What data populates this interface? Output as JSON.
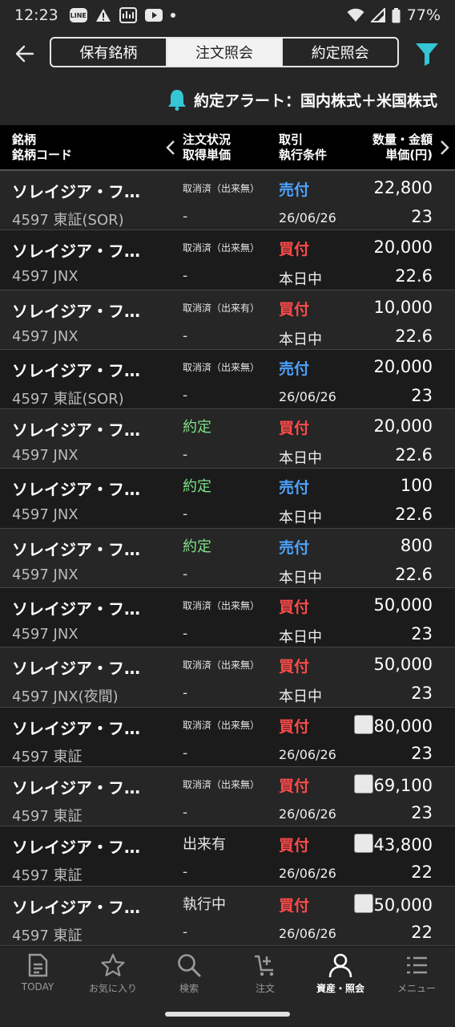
{
  "status_bar": {
    "time": "12:23",
    "battery": "77%"
  },
  "header": {
    "tabs": [
      "保有銘柄",
      "注文照会",
      "約定照会"
    ],
    "active_tab": 1,
    "alert_text": "約定アラート：国内株式＋米国株式"
  },
  "columns": {
    "name": "銘柄",
    "code": "銘柄コード",
    "status": "注文状況",
    "acq": "取得単価",
    "trade": "取引",
    "cond": "執行条件",
    "qty": "数量・金額",
    "price": "単価(円)"
  },
  "orders": [
    {
      "name": "ソレイジア・フ…",
      "code": "4597 東証(SOR)",
      "status": "取消済（出来無）",
      "acq": "-",
      "side": "売付",
      "cond": "26/06/26",
      "qty": "22,800",
      "price": "23"
    },
    {
      "name": "ソレイジア・フ…",
      "code": "4597 JNX",
      "status": "取消済（出来無）",
      "acq": "-",
      "side": "買付",
      "cond": "本日中",
      "qty": "20,000",
      "price": "22.6"
    },
    {
      "name": "ソレイジア・フ…",
      "code": "4597 JNX",
      "status": "取消済（出来有）",
      "acq": "-",
      "side": "買付",
      "cond": "本日中",
      "qty": "10,000",
      "price": "22.6"
    },
    {
      "name": "ソレイジア・フ…",
      "code": "4597 東証(SOR)",
      "status": "取消済（出来無）",
      "acq": "-",
      "side": "売付",
      "cond": "26/06/26",
      "qty": "20,000",
      "price": "23"
    },
    {
      "name": "ソレイジア・フ…",
      "code": "4597 JNX",
      "status": "約定",
      "acq": "-",
      "side": "買付",
      "cond": "本日中",
      "qty": "20,000",
      "price": "22.6"
    },
    {
      "name": "ソレイジア・フ…",
      "code": "4597 JNX",
      "status": "約定",
      "acq": "-",
      "side": "売付",
      "cond": "本日中",
      "qty": "100",
      "price": "22.6"
    },
    {
      "name": "ソレイジア・フ…",
      "code": "4597 JNX",
      "status": "約定",
      "acq": "-",
      "side": "売付",
      "cond": "本日中",
      "qty": "800",
      "price": "22.6"
    },
    {
      "name": "ソレイジア・フ…",
      "code": "4597 JNX",
      "status": "取消済（出来無）",
      "acq": "-",
      "side": "買付",
      "cond": "本日中",
      "qty": "50,000",
      "price": "23"
    },
    {
      "name": "ソレイジア・フ…",
      "code": "4597 JNX(夜間)",
      "status": "取消済（出来無）",
      "acq": "-",
      "side": "買付",
      "cond": "本日中",
      "qty": "50,000",
      "price": "23"
    },
    {
      "name": "ソレイジア・フ…",
      "code": "4597 東証",
      "status": "取消済（出来無）",
      "acq": "-",
      "side": "買付",
      "cond": "26/06/26",
      "qty": "80,000",
      "qty_box": true,
      "price": "23"
    },
    {
      "name": "ソレイジア・フ…",
      "code": "4597 東証",
      "status": "取消済（出来無）",
      "acq": "-",
      "side": "買付",
      "cond": "26/06/26",
      "qty": "69,100",
      "qty_box": true,
      "price": "23"
    },
    {
      "name": "ソレイジア・フ…",
      "code": "4597 東証",
      "status": "出来有",
      "acq": "-",
      "side": "買付",
      "cond": "26/06/26",
      "qty": "43,800",
      "qty_box": true,
      "price": "22"
    },
    {
      "name": "ソレイジア・フ…",
      "code": "4597 東証",
      "status": "執行中",
      "acq": "-",
      "side": "買付",
      "cond": "26/06/26",
      "qty": "50,000",
      "qty_box": true,
      "price": "22"
    }
  ],
  "bottom_nav": [
    {
      "label": "TODAY",
      "icon": "document-icon"
    },
    {
      "label": "お気に入り",
      "icon": "star-icon"
    },
    {
      "label": "検索",
      "icon": "search-icon"
    },
    {
      "label": "注文",
      "icon": "cart-icon"
    },
    {
      "label": "資産・照会",
      "icon": "person-icon",
      "active": true
    },
    {
      "label": "メニュー",
      "icon": "menu-icon"
    }
  ]
}
